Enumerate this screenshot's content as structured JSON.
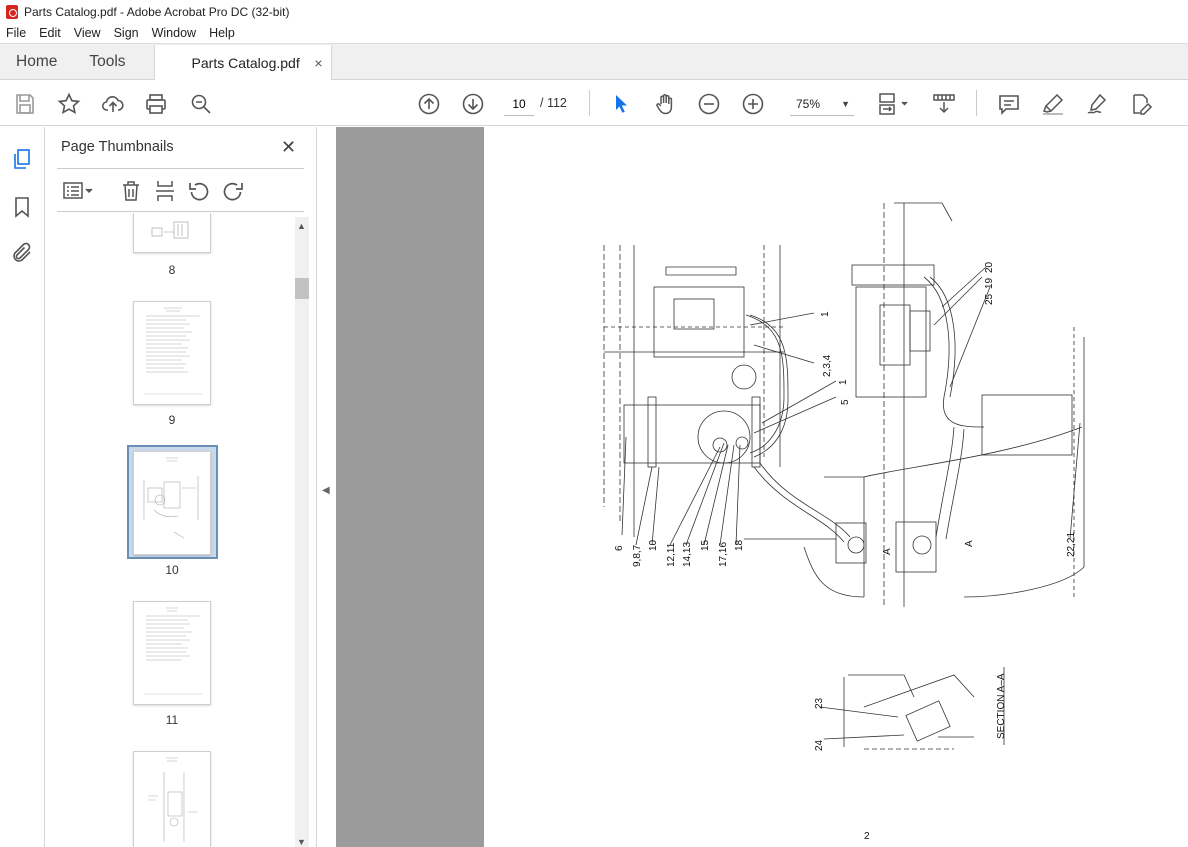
{
  "window": {
    "title": "Parts Catalog.pdf - Adobe Acrobat Pro DC (32-bit)"
  },
  "menu": [
    "File",
    "Edit",
    "View",
    "Sign",
    "Window",
    "Help"
  ],
  "tabs": {
    "home": "Home",
    "tools": "Tools",
    "document": "Parts Catalog.pdf",
    "close": "×"
  },
  "toolbar": {
    "current_page": "10",
    "total_pages": "/ 112",
    "zoom": "75%"
  },
  "panel": {
    "title": "Page Thumbnails",
    "close": "✕",
    "thumbnails": [
      {
        "label": "8"
      },
      {
        "label": "9"
      },
      {
        "label": "10",
        "selected": true
      },
      {
        "label": "11"
      },
      {
        "label": ""
      }
    ]
  },
  "document": {
    "callouts": [
      "1",
      "2,3,4",
      "1",
      "5",
      "6",
      "9,8,7",
      "10",
      "12,11",
      "14,13",
      "15",
      "17,16",
      "18",
      "A",
      "A",
      "20",
      "19",
      "25",
      "22,21",
      "23",
      "24",
      "SECTION A–A"
    ],
    "page_number": "2"
  },
  "colors": {
    "accent": "#1473e6",
    "viewer_bg": "#9b9b9b",
    "selection": "#c9d9ea"
  }
}
